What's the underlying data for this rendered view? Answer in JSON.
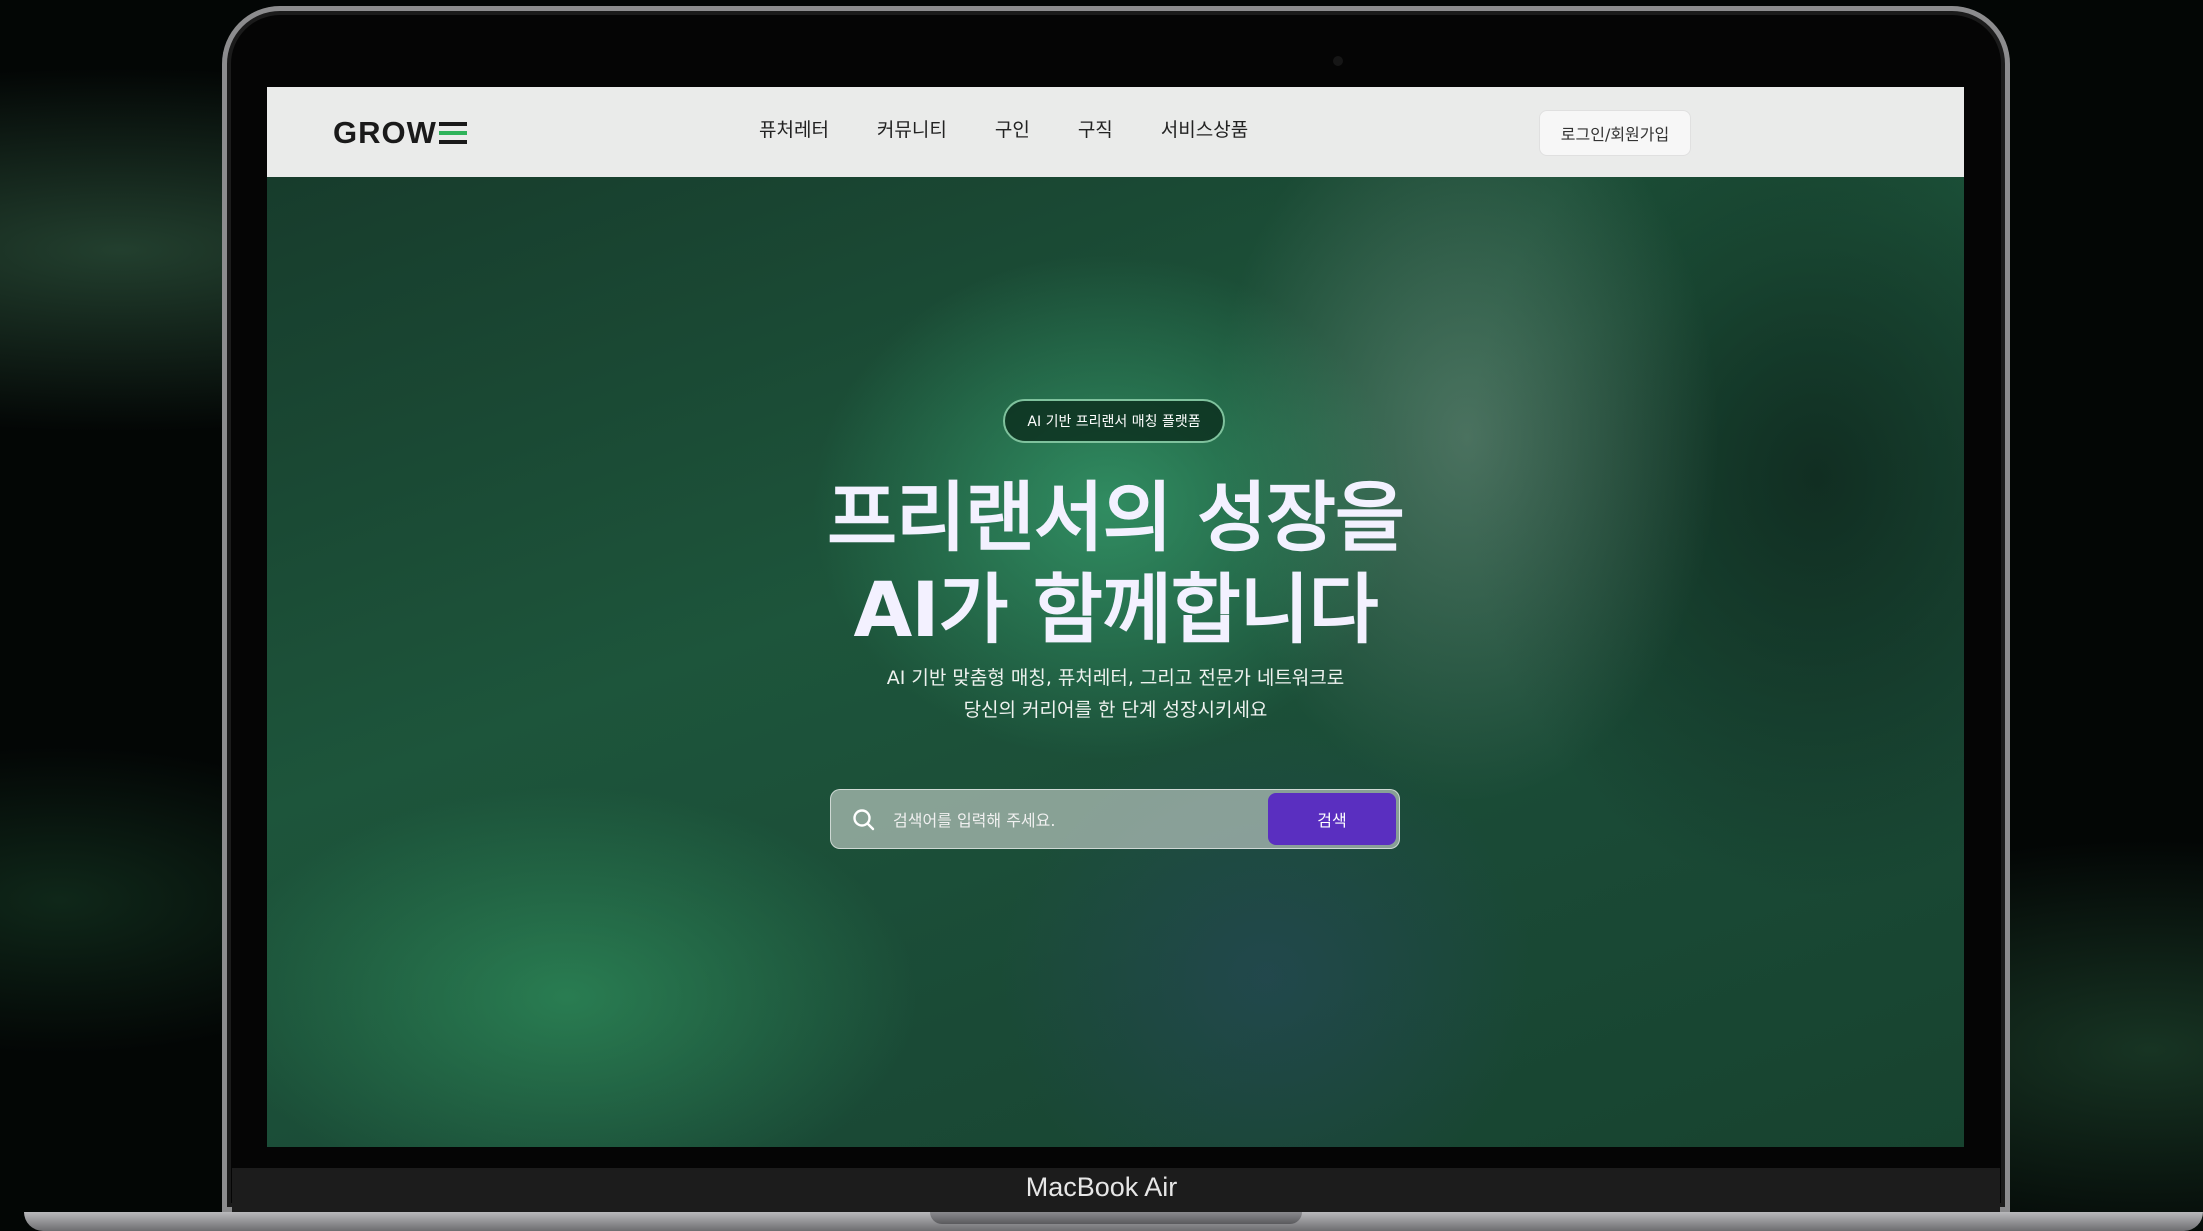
{
  "device": {
    "label": "MacBook Air"
  },
  "header": {
    "logo_text": "GROW",
    "nav": [
      {
        "label": "퓨처레터"
      },
      {
        "label": "커뮤니티"
      },
      {
        "label": "구인"
      },
      {
        "label": "구직"
      },
      {
        "label": "서비스상품"
      }
    ],
    "login_label": "로그인/회원가입"
  },
  "hero": {
    "badge": "AI 기반 프리랜서 매칭 플랫폼",
    "headline_line1": "프리랜서의 성장을",
    "headline_line2": "AI가 함께합니다",
    "subtitle_line1": "AI 기반 맞춤형 매칭, 퓨처레터, 그리고 전문가 네트워크로",
    "subtitle_line2": "당신의 커리어를 한 단계 성장시키세요"
  },
  "search": {
    "placeholder": "검색어를 입력해 주세요.",
    "button_label": "검색",
    "icon": "search-icon"
  },
  "colors": {
    "accent": "#5a2fc0",
    "brand_green": "#2fb35a",
    "navbar_bg": "#eaebea"
  }
}
